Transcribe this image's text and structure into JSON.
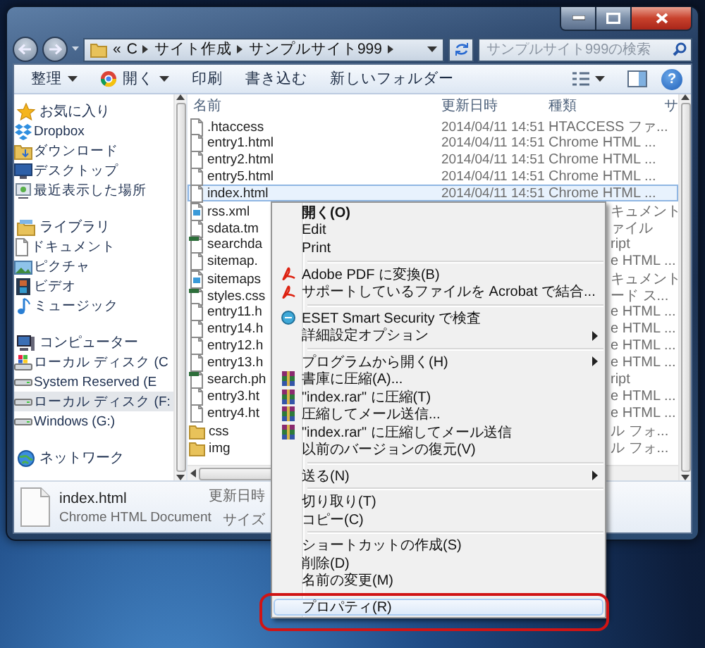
{
  "address_bar": {
    "overflow": "«",
    "crumbs": [
      "C",
      "サイト作成",
      "サンプルサイト999"
    ]
  },
  "search": {
    "placeholder": "サンプルサイト999の検索"
  },
  "toolbar": {
    "commands": [
      {
        "label": "整理",
        "kind": "menu"
      },
      {
        "label": "開く",
        "kind": "app-menu"
      },
      {
        "label": "印刷",
        "kind": "plain"
      },
      {
        "label": "書き込む",
        "kind": "plain"
      },
      {
        "label": "新しいフォルダー",
        "kind": "plain"
      }
    ],
    "help": "?"
  },
  "sidebar": {
    "groups": [
      {
        "label": "お気に入り",
        "kind": "star",
        "selected": false,
        "children": [
          {
            "label": "Dropbox",
            "kind": "dropbox",
            "selected": false
          },
          {
            "label": "ダウンロード",
            "kind": "folder",
            "selected": false
          },
          {
            "label": "デスクトップ",
            "kind": "desktop",
            "selected": false
          },
          {
            "label": "最近表示した場所",
            "kind": "recent",
            "selected": false
          }
        ]
      },
      {
        "label": "ライブラリ",
        "kind": "library",
        "selected": false,
        "children": [
          {
            "label": "ドキュメント",
            "kind": "document",
            "selected": false
          },
          {
            "label": "ピクチャ",
            "kind": "picture",
            "selected": false
          },
          {
            "label": "ビデオ",
            "kind": "video",
            "selected": false
          },
          {
            "label": "ミュージック",
            "kind": "music",
            "selected": false
          }
        ]
      },
      {
        "label": "コンピューター",
        "kind": "computer",
        "selected": false,
        "children": [
          {
            "label": "ローカル ディスク (C",
            "kind": "system-drive",
            "selected": false
          },
          {
            "label": "System Reserved (E",
            "kind": "drive",
            "selected": false
          },
          {
            "label": "ローカル ディスク (F:",
            "kind": "drive",
            "selected": true
          },
          {
            "label": "Windows (G:)",
            "kind": "drive",
            "selected": false
          }
        ]
      },
      {
        "label": "ネットワーク",
        "kind": "network",
        "selected": false
      }
    ]
  },
  "file_list": {
    "columns": [
      "名前",
      "更新日時",
      "種類",
      "サ"
    ],
    "rows": [
      {
        "name": ".htaccess",
        "modified": "2014/04/11 14:51",
        "type": "HTACCESS ファ...",
        "kind": "file",
        "selected": false
      },
      {
        "name": "entry1.html",
        "modified": "2014/04/11 14:51",
        "type": "Chrome HTML ...",
        "kind": "file",
        "selected": false
      },
      {
        "name": "entry2.html",
        "modified": "2014/04/11 14:51",
        "type": "Chrome HTML ...",
        "kind": "file",
        "selected": false
      },
      {
        "name": "entry5.html",
        "modified": "2014/04/11 14:51",
        "type": "Chrome HTML ...",
        "kind": "file",
        "selected": false
      },
      {
        "name": "index.html",
        "modified": "2014/04/11 14:51",
        "type": "Chrome HTML ...",
        "kind": "file",
        "selected": true
      },
      {
        "name": "rss.xml",
        "type": "キュメント",
        "kind": "data",
        "selected": false
      },
      {
        "name": "sdata.tm",
        "type": "ァイル",
        "kind": "file",
        "selected": false
      },
      {
        "name": "searchda",
        "type": "ript",
        "kind": "script",
        "selected": false
      },
      {
        "name": "sitemap.",
        "type": "e HTML ...",
        "kind": "file",
        "selected": false
      },
      {
        "name": "sitemaps",
        "type": "キュメント",
        "kind": "data",
        "selected": false
      },
      {
        "name": "styles.css",
        "type": "ード ス...",
        "kind": "script",
        "selected": false
      },
      {
        "name": "entry11.h",
        "type": "e HTML ...",
        "kind": "file",
        "selected": false
      },
      {
        "name": "entry14.h",
        "type": "e HTML ...",
        "kind": "file",
        "selected": false
      },
      {
        "name": "entry12.h",
        "type": "e HTML ...",
        "kind": "file",
        "selected": false
      },
      {
        "name": "entry13.h",
        "type": "e HTML ...",
        "kind": "file",
        "selected": false
      },
      {
        "name": "search.ph",
        "type": "ript",
        "kind": "script",
        "selected": false
      },
      {
        "name": "entry3.ht",
        "type": "e HTML ...",
        "kind": "file",
        "selected": false
      },
      {
        "name": "entry4.ht",
        "type": "e HTML ...",
        "kind": "file",
        "selected": false
      },
      {
        "name": "css",
        "type": "ル フォ...",
        "kind": "folder",
        "selected": false
      },
      {
        "name": "img",
        "type": "ル フォ...",
        "kind": "folder",
        "selected": false
      }
    ]
  },
  "details": {
    "name": "index.html",
    "type": "Chrome HTML Document",
    "labels": [
      "更新日時",
      "サイズ"
    ]
  },
  "context_menu": {
    "groups": [
      [
        {
          "label": "開く(O)",
          "bold": true,
          "kind": "none",
          "submenu": false,
          "selected": false
        },
        {
          "label": "Edit",
          "bold": false,
          "kind": "none",
          "submenu": false,
          "selected": false
        },
        {
          "label": "Print",
          "bold": false,
          "kind": "none",
          "submenu": false,
          "selected": false
        }
      ],
      [
        {
          "label": "Adobe PDF に変換(B)",
          "bold": false,
          "kind": "pdf",
          "submenu": false,
          "selected": false
        },
        {
          "label": "サポートしているファイルを Acrobat で結合...",
          "bold": false,
          "kind": "pdf",
          "submenu": false,
          "selected": false
        }
      ],
      [
        {
          "label": "ESET Smart Security で検査",
          "bold": false,
          "kind": "eset",
          "submenu": false,
          "selected": false
        },
        {
          "label": "詳細設定オプション",
          "bold": false,
          "kind": "none",
          "submenu": true,
          "selected": false
        }
      ],
      [
        {
          "label": "プログラムから開く(H)",
          "bold": false,
          "kind": "none",
          "submenu": true,
          "selected": false
        },
        {
          "label": "書庫に圧縮(A)...",
          "bold": false,
          "kind": "rar",
          "submenu": false,
          "selected": false
        },
        {
          "label": "\"index.rar\" に圧縮(T)",
          "bold": false,
          "kind": "rar",
          "submenu": false,
          "selected": false
        },
        {
          "label": "圧縮してメール送信...",
          "bold": false,
          "kind": "rar",
          "submenu": false,
          "selected": false
        },
        {
          "label": "\"index.rar\" に圧縮してメール送信",
          "bold": false,
          "kind": "rar",
          "submenu": false,
          "selected": false
        },
        {
          "label": "以前のバージョンの復元(V)",
          "bold": false,
          "kind": "none",
          "submenu": false,
          "selected": false
        }
      ],
      [
        {
          "label": "送る(N)",
          "bold": false,
          "kind": "none",
          "submenu": true,
          "selected": false
        }
      ],
      [
        {
          "label": "切り取り(T)",
          "bold": false,
          "kind": "none",
          "submenu": false,
          "selected": false
        },
        {
          "label": "コピー(C)",
          "bold": false,
          "kind": "none",
          "submenu": false,
          "selected": false
        }
      ],
      [
        {
          "label": "ショートカットの作成(S)",
          "bold": false,
          "kind": "none",
          "submenu": false,
          "selected": false
        },
        {
          "label": "削除(D)",
          "bold": false,
          "kind": "none",
          "submenu": false,
          "selected": false
        },
        {
          "label": "名前の変更(M)",
          "bold": false,
          "kind": "none",
          "submenu": false,
          "selected": false
        }
      ],
      [
        {
          "label": "プロパティ(R)",
          "bold": false,
          "kind": "none",
          "submenu": false,
          "selected": true
        }
      ]
    ]
  }
}
